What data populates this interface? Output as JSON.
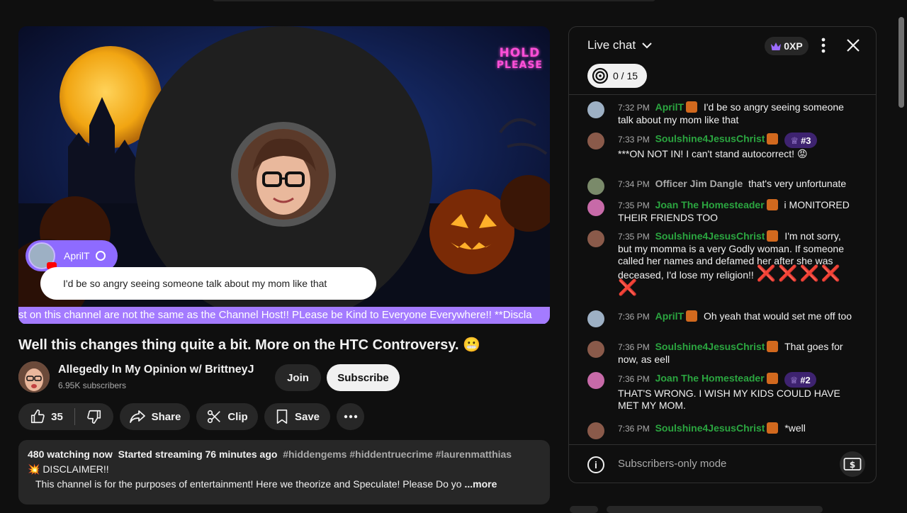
{
  "player": {
    "hold_line1": "HOLD",
    "hold_line2": "PLEASE",
    "overlay_name": "AprilT",
    "overlay_message": "I'd be so angry seeing someone talk about my mom like that",
    "ticker_text": "st on this channel are not the same as the Channel Host!! PLease be Kind to Everyone Everywhere!! **Discla"
  },
  "video": {
    "title": "Well this changes thing quite a bit. More on the HTC Controversy. 😬",
    "channel_name": "Allegedly In My Opinion w/ BrittneyJ",
    "subscribers": "6.95K subscribers",
    "join_label": "Join",
    "subscribe_label": "Subscribe",
    "like_count": "35",
    "share_label": "Share",
    "clip_label": "Clip",
    "save_label": "Save"
  },
  "description": {
    "watching": "480 watching now",
    "started": "Started streaming 76 minutes ago",
    "tags": "#hiddengems #hiddentruecrime #laurenmatthias",
    "line2": "💥 DISCLAIMER!!",
    "line3": "This channel is for the purposes of entertainment!  Here we theorize and Speculate!  Please Do yo",
    "more_label": "...more"
  },
  "chat": {
    "title": "Live chat",
    "xp": "0XP",
    "goal": "0 / 15",
    "footer_mode": "Subscribers-only mode",
    "messages": [
      {
        "time": "7:32 PM",
        "author": "AprilT",
        "text": "I'd be so angry seeing someone talk about my mom like that"
      },
      {
        "time": "7:33 PM",
        "author": "Soulshine4JesusChrist",
        "rank": "#3",
        "text": "***ON NOT IN! I can't stand autocorrect! 😡"
      },
      {
        "time": "7:34 PM",
        "author": "Officer Jim Dangle",
        "text": "that's very unfortunate"
      },
      {
        "time": "7:35 PM",
        "author": "Joan The Homesteader",
        "text": "i MONITORED THEIR FRIENDS TOO"
      },
      {
        "time": "7:35 PM",
        "author": "Soulshine4JesusChrist",
        "text": "I'm not sorry, but my momma is a very Godly woman. If someone called her names and defamed her after she was deceased, I'd lose my religion!!",
        "emoji": "❌❌❌❌",
        "emoji2": "❌"
      },
      {
        "time": "7:36 PM",
        "author": "AprilT",
        "text": "Oh yeah that would set me off too"
      },
      {
        "time": "7:36 PM",
        "author": "Soulshine4JesusChrist",
        "text": "That goes for now, as eell"
      },
      {
        "time": "7:36 PM",
        "author": "Joan The Homesteader",
        "rank": "#2",
        "text": "THAT'S WRONG. I WISH MY KIDS COULD HAVE MET MY MOM."
      },
      {
        "time": "7:36 PM",
        "author": "Soulshine4JesusChrist",
        "text": "*well"
      }
    ]
  },
  "colors": {
    "accent_purple": "#a47bff",
    "author_green": "#2ba640",
    "rank_purple": "#3e2370"
  }
}
